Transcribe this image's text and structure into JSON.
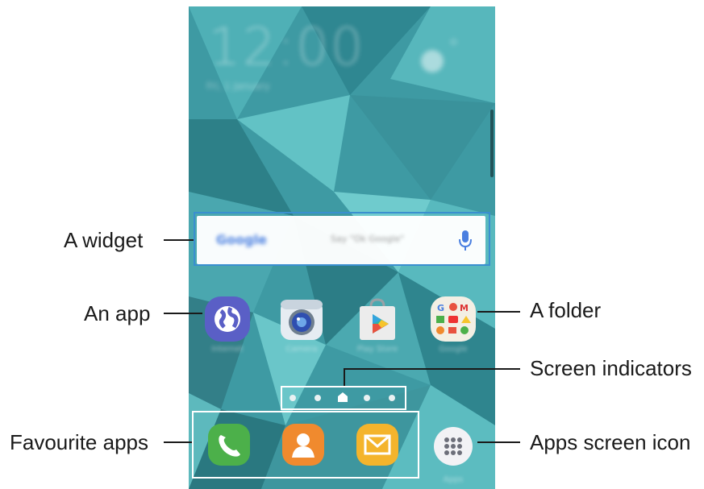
{
  "home_screen": {
    "clock": "12:00",
    "date": "Fri, 1 January",
    "search_widget": {
      "logo": "Google",
      "hint": "Say \"Ok Google\""
    },
    "apps": [
      {
        "label": "Internet",
        "icon": "globe-icon",
        "color": "#5a5fc6"
      },
      {
        "label": "Camera",
        "icon": "camera-icon",
        "color": "#e9eef3"
      },
      {
        "label": "Play Store",
        "icon": "play-store-icon",
        "color": "#e9e9e9"
      },
      {
        "label": "Google",
        "icon": "google-folder-icon",
        "color": "#f2efe6"
      }
    ],
    "favourites": [
      {
        "label": "Phone",
        "icon": "phone-icon",
        "color": "#4cb04a"
      },
      {
        "label": "Contacts",
        "icon": "contacts-icon",
        "color": "#f08a2e"
      },
      {
        "label": "Messages",
        "icon": "messages-icon",
        "color": "#f4b42c"
      },
      {
        "label": "Apps",
        "icon": "apps-grid-icon",
        "color": "#f2f2f5"
      }
    ],
    "indicators": {
      "count": 5,
      "current": 3
    }
  },
  "callouts": {
    "widget": "A widget",
    "app": "An app",
    "folder": "A folder",
    "indicators": "Screen indicators",
    "favourites": "Favourite apps",
    "apps_screen": "Apps screen icon"
  },
  "colors": {
    "highlight": "#3a8fd0",
    "wallpaper": "#3f9aa2"
  }
}
